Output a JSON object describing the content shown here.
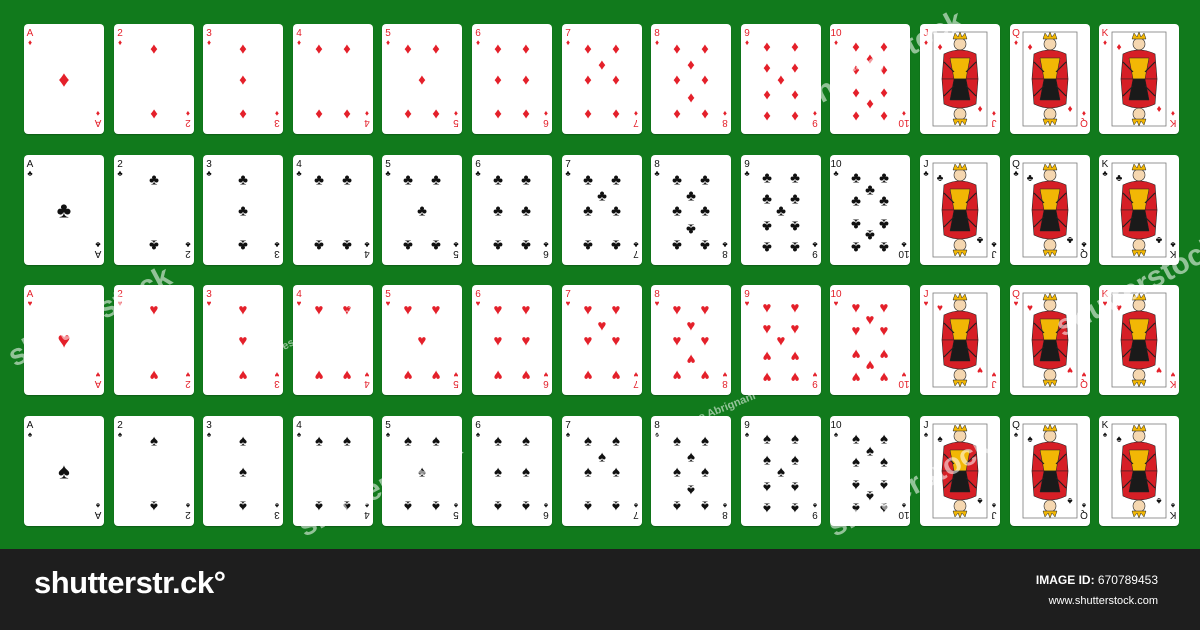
{
  "colors": {
    "felt": "#117a1c",
    "red_suit": "#e4202a",
    "black_suit": "#111111",
    "bottom_bar": "#1e1e1e",
    "court_gold": "#f2b705",
    "court_red": "#d61f26"
  },
  "deck": {
    "ranks": [
      "A",
      "2",
      "3",
      "4",
      "5",
      "6",
      "7",
      "8",
      "9",
      "10",
      "J",
      "Q",
      "K"
    ],
    "suits": [
      {
        "name": "diamonds",
        "symbol": "♦",
        "color": "#e4202a"
      },
      {
        "name": "clubs",
        "symbol": "♣",
        "color": "#111111"
      },
      {
        "name": "hearts",
        "symbol": "♥",
        "color": "#e4202a"
      },
      {
        "name": "spades",
        "symbol": "♠",
        "color": "#111111"
      }
    ]
  },
  "watermark": {
    "text": "shutterstock",
    "credit": "Francesco Abrignani"
  },
  "footer": {
    "brand": "shutterstr.ck°",
    "image_id_label": "IMAGE ID:",
    "image_id": "670789453",
    "url": "www.shutterstock.com"
  }
}
